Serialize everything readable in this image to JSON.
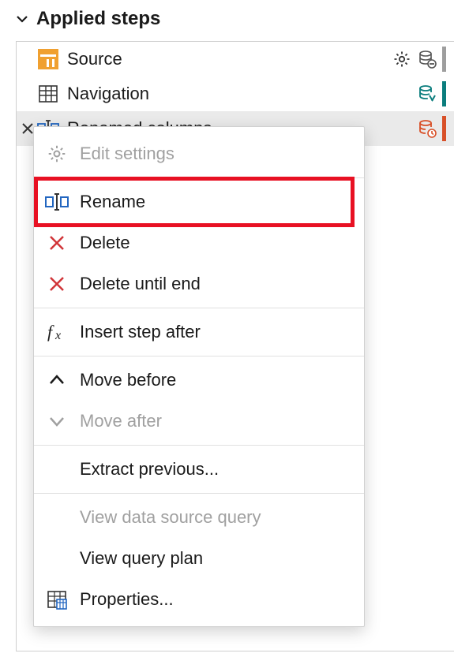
{
  "header": {
    "title": "Applied steps"
  },
  "steps": [
    {
      "label": "Source"
    },
    {
      "label": "Navigation"
    },
    {
      "label": "Renamed columns"
    }
  ],
  "menu": {
    "edit_settings": "Edit settings",
    "rename": "Rename",
    "delete": "Delete",
    "delete_until_end": "Delete until end",
    "insert_step_after": "Insert step after",
    "move_before": "Move before",
    "move_after": "Move after",
    "extract_previous": "Extract previous...",
    "view_data_source_query": "View data source query",
    "view_query_plan": "View query plan",
    "properties": "Properties..."
  }
}
